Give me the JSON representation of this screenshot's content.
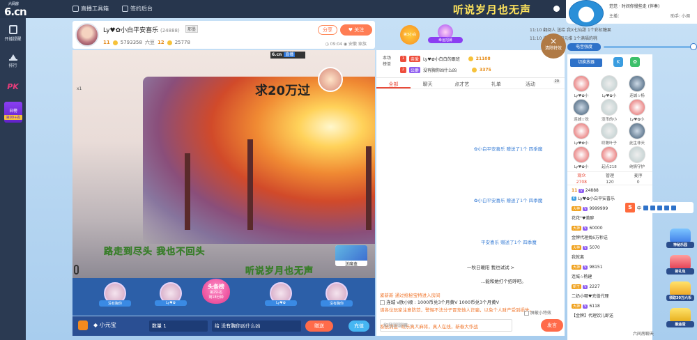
{
  "topbar": {
    "logo_small": "六间房",
    "logo_main": "6.cn",
    "link1": "直播工具箱",
    "link2": "签约后台",
    "marquee": "听说岁月也无声"
  },
  "sidebar": {
    "items": [
      {
        "label": "开播提醒"
      },
      {
        "label": "排行"
      },
      {
        "label": "PK"
      }
    ],
    "daybang": {
      "label": "日榜",
      "rank": "第99+名"
    }
  },
  "anchor": {
    "name": "Ly♥✿小白平安喜乐",
    "id": "(24888)",
    "tag": "那墨",
    "level": "11",
    "fans": "5793358",
    "fans_label": "六豆",
    "level2": "12",
    "score": "25778",
    "time": "09:04",
    "loc": "安徽",
    "family": "家族",
    "share": "分享",
    "follow": "关注"
  },
  "promos": {
    "p1": "第3小白",
    "p2": "幸运招募"
  },
  "gift_news": {
    "time1": "11:10",
    "text1": "翻阅人 送给 我X七仙甜 1个彩虹糖果",
    "time2": "11:10",
    "text2": "连接 - 李四元维 1个满福的桃"
  },
  "video": {
    "room_tag": "6.cn",
    "room_tag_label": "直播",
    "overlay1": "求20万过",
    "overlay2": "路走到尽头  我也不回头",
    "overlay3": "听说岁月也无声",
    "user_mini": "x1",
    "box_gift": "送魔盒"
  },
  "seats": {
    "items": [
      {
        "name": "没有胸你"
      },
      {
        "name": "Ly♥✿"
      },
      {
        "name": "Ly♥✿"
      },
      {
        "name": "没有胸你"
      }
    ],
    "toubang": {
      "title": "头条榜",
      "rank": "第29-名",
      "sub": "剩18分钟"
    }
  },
  "giftbar": {
    "item": "小元宝",
    "qty_label": "数量",
    "qty": "1",
    "to_label": "给",
    "to": "没有胸你凶什么凶",
    "give": "赠送",
    "recharge": "充值"
  },
  "rank_box": {
    "title1": "本场",
    "title2": "榜单",
    "rows": [
      {
        "no": "1",
        "tag": "亲爱",
        "name": "Ly♥✿小白白的跟班",
        "amount": "21108"
      },
      {
        "no": "2",
        "tag": "公爵",
        "name": "没有胸你凶什么凶",
        "amount": "3375"
      }
    ]
  },
  "clear_fx": "清除特效",
  "chat_tabs": [
    {
      "label": "全部"
    },
    {
      "label": "聊天"
    },
    {
      "label": "点才艺"
    },
    {
      "label": "礼单"
    },
    {
      "label": "活动"
    }
  ],
  "chat_badge": "20",
  "chat_lines": [
    {
      "text": "✿小白平安喜乐  赠送了1个 四季魔"
    },
    {
      "text": "✿小白平安喜乐  赠送了1个 四季魔"
    },
    {
      "text": "平安喜乐  赠送了1个 四季魔"
    },
    {
      "text": "一秋日暖阳  我也试试 >"
    },
    {
      "text": "...能和她打个招呼吧。"
    },
    {
      "text": "紧新新 通过抢秘宝特进入房间"
    },
    {
      "text": "请各位玩家注意防范，警惕不法分子冒充他人诈骗，以免个人财产受到损失。"
    },
    {
      "text": "系统消息: 欢乐真人麻将，真人在线，新春大作战"
    }
  ],
  "chat_promo": "连城 v欧小顺 : 1000币兑3个月黄V 1000币兑3个月黄V",
  "chat_ctrl": {
    "shield": "屏蔽小特效",
    "placeholder": "和我聊聊嘛 ~ ~",
    "send": "发言"
  },
  "right_top": {
    "name": "范范 · 时间你慢些走 (伴奏)",
    "sub1": "主播：",
    "sub2": "助手: 小调"
  },
  "slider": {
    "label": "电音强度"
  },
  "viewer": {
    "title": "切换放器",
    "cells": [
      {
        "name": "Ly♥✿小"
      },
      {
        "name": "Ly♥✿小"
      },
      {
        "name": "连城☆杨"
      },
      {
        "name": "连城☆欢"
      },
      {
        "name": "没币的小"
      },
      {
        "name": "Ly♥✿小"
      },
      {
        "name": "Ly♥✿小"
      },
      {
        "name": "叹聪叶子"
      },
      {
        "name": "此生非天"
      },
      {
        "name": "Ly♥✿小"
      },
      {
        "name": "起点218"
      },
      {
        "name": "纯情守护"
      }
    ],
    "stats": [
      {
        "label": "观众",
        "value": "2708"
      },
      {
        "label": "管理",
        "value": "120"
      },
      {
        "label": "麦序",
        "value": "0"
      }
    ],
    "list": [
      {
        "lv": "11",
        "text": "24888"
      },
      {
        "lv": "",
        "text": "Ly♥✿小白平安喜乐"
      },
      {
        "lv": "大神",
        "text": "9999999"
      },
      {
        "lv": "",
        "text": "花花°♥美醉"
      },
      {
        "lv": "大神",
        "text": "60000"
      },
      {
        "lv": "",
        "text": "金牌代理找6万秒送"
      },
      {
        "lv": "大神",
        "text": "5070"
      },
      {
        "lv": "",
        "text": "我就离"
      },
      {
        "lv": "大神",
        "text": "98151"
      },
      {
        "lv": "",
        "text": "连城☆杨建"
      },
      {
        "lv": "新王",
        "text": "2227"
      },
      {
        "lv": "",
        "text": "二奶小哪♥充值代理"
      },
      {
        "lv": "大神",
        "text": "6118"
      },
      {
        "lv": "",
        "text": "【金牌】代理饮儿即送"
      }
    ]
  },
  "float_tools": {
    "s": "S",
    "lang": "中"
  },
  "right_icons": [
    {
      "label": "神秘乐园"
    },
    {
      "label": "新礼包"
    },
    {
      "label": "领取30万六币"
    },
    {
      "label": "融金蛋"
    }
  ],
  "bottom_msg": "六间房聊天",
  "colors": {
    "accent": "#ff6b4a",
    "blue": "#2e72c9",
    "dark": "#27364d"
  }
}
